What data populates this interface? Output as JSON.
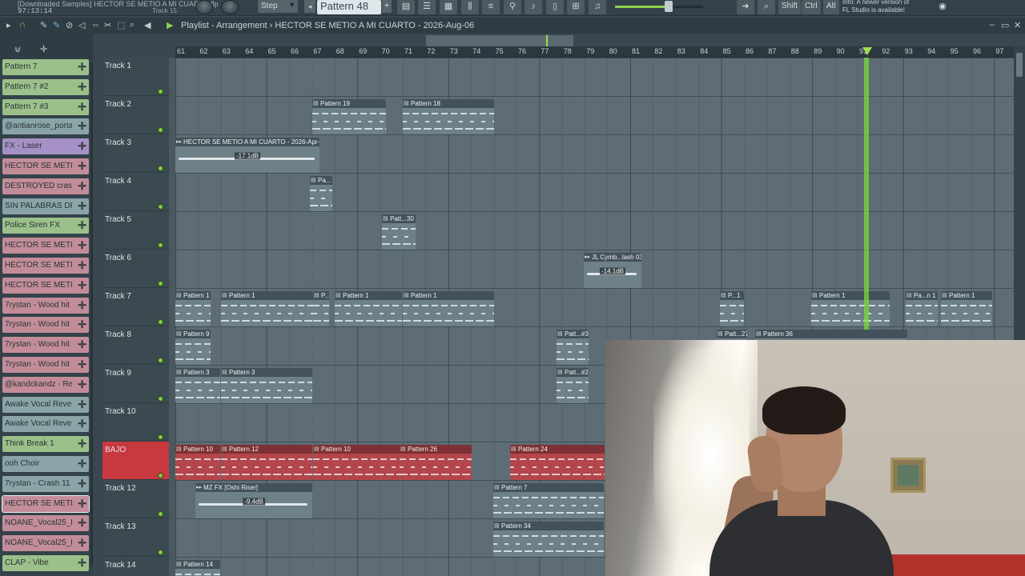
{
  "app": {
    "project_file": "[Downloaded Samples] HECTOR SE METIO A MI CUARTO.flp",
    "time": "97:13:14",
    "hint_track": "Track 15",
    "step_mode": "Step",
    "pattern_current": "Pattern 48",
    "keys": [
      "Shift",
      "Ctrl",
      "Alt"
    ],
    "notice_line1": "Info: A newer version of",
    "notice_line2": "FL Studio is available!"
  },
  "playlist": {
    "window_title": "Playlist - Arrangement",
    "breadcrumb": "HECTOR SE METIO A MI CUARTO - 2026-Aug-06",
    "bar_numbers": [
      "61",
      "62",
      "63",
      "64",
      "65",
      "66",
      "67",
      "68",
      "69",
      "70",
      "71",
      "72",
      "73",
      "74",
      "75",
      "76",
      "77",
      "78",
      "79",
      "80",
      "81",
      "82",
      "83",
      "84",
      "85",
      "86",
      "87",
      "88",
      "89",
      "90",
      "91",
      "92",
      "93",
      "94",
      "95",
      "96",
      "97"
    ],
    "tracks": [
      "Track 1",
      "Track 2",
      "Track 3",
      "Track 4",
      "Track 5",
      "Track 6",
      "Track 7",
      "Track 8",
      "Track 9",
      "Track 10",
      "BAJO",
      "Track 12",
      "Track 13",
      "Track 14"
    ]
  },
  "picker": [
    {
      "label": "Pattern 7",
      "color": "#9bc08a"
    },
    {
      "label": "Pattern 7 #2",
      "color": "#9bc08a"
    },
    {
      "label": "Pattern 7 #3",
      "color": "#9bc08a"
    },
    {
      "label": "@antianrose_portal...",
      "color": "#8aa4a8"
    },
    {
      "label": "FX - Laser",
      "color": "#a591c5"
    },
    {
      "label": "HECTOR SE METIO A...",
      "color": "#c28d98"
    },
    {
      "label": "DESTROYED crash (8)",
      "color": "#c28d98"
    },
    {
      "label": "SIN PALABRAS DRAJO...",
      "color": "#8aa4a8"
    },
    {
      "label": "Police Siren FX",
      "color": "#9bc08a"
    },
    {
      "label": "HECTOR SE METIO A...",
      "color": "#c28d98"
    },
    {
      "label": "HECTOR SE METIO A...",
      "color": "#c28d98"
    },
    {
      "label": "HECTOR SE METIO A...",
      "color": "#c28d98"
    },
    {
      "label": "7rystan - Wood hit r...",
      "color": "#c28d98"
    },
    {
      "label": "7rystan - Wood hit r...",
      "color": "#c28d98"
    },
    {
      "label": "7rystan - Wood hit r...",
      "color": "#c28d98"
    },
    {
      "label": "7rystan - Wood hit r...",
      "color": "#c28d98"
    },
    {
      "label": "@kandckandz - Rev...",
      "color": "#c28d98"
    },
    {
      "label": "Awake Vocal Reverb...",
      "color": "#8aa4a8"
    },
    {
      "label": "Awake Vocal Reverb...",
      "color": "#8aa4a8"
    },
    {
      "label": "Think Break 1",
      "color": "#9bc08a"
    },
    {
      "label": "ooh Choir",
      "color": "#8aa4a8"
    },
    {
      "label": "7rystan - Crash 11",
      "color": "#8aa4a8"
    },
    {
      "label": "HECTOR SE METIO A...",
      "color": "#c28d98"
    },
    {
      "label": "NOANE_Vocal25_Hee...",
      "color": "#c28d98"
    },
    {
      "label": "NOANE_Vocal25_Hee...",
      "color": "#c28d98"
    },
    {
      "label": "CLAP - Vibe",
      "color": "#9bc08a"
    }
  ],
  "clips": [
    {
      "name": "Pattern 19",
      "kind": "notes"
    },
    {
      "name": "Pattern 18",
      "kind": "notes"
    },
    {
      "name": "HECTOR SE METIO A MI CUARTO - 2026-Apr-27",
      "kind": "audio",
      "vol": "-17.1dB"
    },
    {
      "name": "Pa...",
      "kind": "notes"
    },
    {
      "name": "Patt...30",
      "kind": "notes"
    },
    {
      "name": "JL Cymb...lash 03",
      "kind": "audio",
      "vol": "-14.1dB"
    },
    {
      "name": "Pattern 1",
      "kind": "notes"
    },
    {
      "name": "Pattern 1",
      "kind": "notes"
    },
    {
      "name": "P...",
      "kind": "notes"
    },
    {
      "name": "Pattern 1",
      "kind": "notes"
    },
    {
      "name": "Pattern 1",
      "kind": "notes"
    },
    {
      "name": "P...1",
      "kind": "notes"
    },
    {
      "name": "Pattern 1",
      "kind": "notes"
    },
    {
      "name": "Pa...n 1",
      "kind": "notes"
    },
    {
      "name": "Pattern 1",
      "kind": "notes"
    },
    {
      "name": "Pattern 9",
      "kind": "notes"
    },
    {
      "name": "Patt...#3",
      "kind": "notes"
    },
    {
      "name": "Patt...27",
      "kind": "notes"
    },
    {
      "name": "Pattern 36",
      "kind": "notes"
    },
    {
      "name": "Pattern 3",
      "kind": "notes"
    },
    {
      "name": "Pattern 3",
      "kind": "notes"
    },
    {
      "name": "Patt...#2",
      "kind": "notes"
    },
    {
      "name": "Pattern 10",
      "kind": "red"
    },
    {
      "name": "Pattern 12",
      "kind": "red"
    },
    {
      "name": "Pattern 10",
      "kind": "red"
    },
    {
      "name": "Pattern 26",
      "kind": "red"
    },
    {
      "name": "Pattern 24",
      "kind": "red"
    },
    {
      "name": "MZ FX [Oshi Riser]",
      "kind": "audio",
      "vol": "-9.4dB"
    },
    {
      "name": "Pattern 7",
      "kind": "notes"
    },
    {
      "name": "Pattern 34",
      "kind": "notes"
    },
    {
      "name": "Pattern 14",
      "kind": "notes"
    }
  ],
  "colors": {
    "accent": "#9be04c",
    "selected_track": "#c8383f"
  }
}
